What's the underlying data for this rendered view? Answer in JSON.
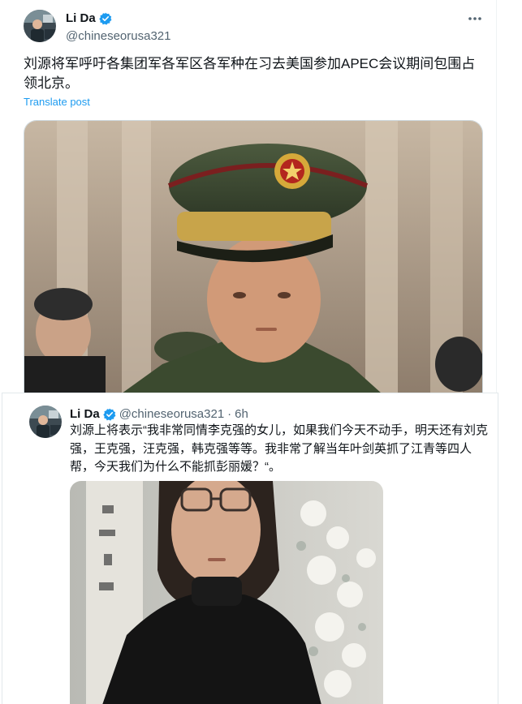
{
  "tweet1": {
    "author_name": "Li Da",
    "handle": "@chineseorusa321",
    "text": "刘源将军呼吁各集团军各军区各军种在习去美国参加APEC会议期间包围占领北京。",
    "translate_label": "Translate post",
    "more_icon": "more-horizontal-icon",
    "verified_icon": "verified-badge-icon"
  },
  "tweet2": {
    "author_name": "Li Da",
    "handle": "@chineseorusa321",
    "separator": "·",
    "time": "6h",
    "text": "刘源上将表示“我非常同情李克强的女儿，如果我们今天不动手，明天还有刘克强，王克强，汪克强，韩克强等等。我非常了解当年叶剑英抓了江青等四人帮，今天我们为什么不能抓彭丽媛？“。"
  },
  "colors": {
    "accent": "#1d9bf0",
    "secondary_text": "#536471",
    "primary_text": "#0f1419"
  }
}
